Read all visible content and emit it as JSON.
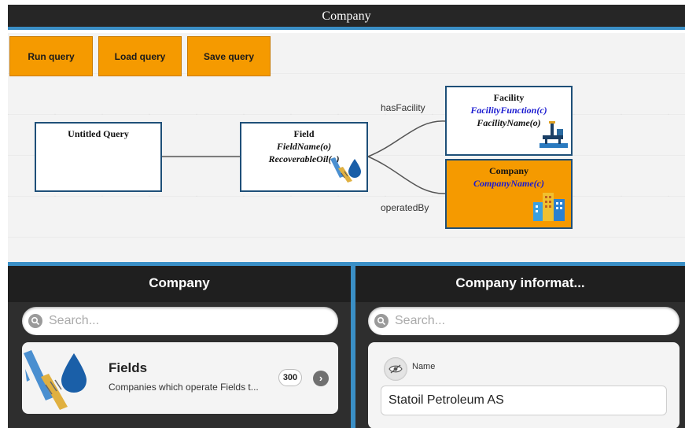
{
  "window": {
    "title": "Company"
  },
  "toolbar": {
    "run_label": "Run query",
    "load_label": "Load query",
    "save_label": "Save query"
  },
  "graph": {
    "nodes": {
      "untitled": {
        "title": "Untitled Query"
      },
      "field": {
        "title": "Field",
        "props": [
          "FieldName(o)",
          "RecoverableOil(o)"
        ],
        "icon": "oil-field-icon"
      },
      "facility": {
        "title": "Facility",
        "props": [
          "FacilityFunction(c)",
          "FacilityName(o)"
        ],
        "icon": "oil-platform-icon"
      },
      "company": {
        "title": "Company",
        "props": [
          "CompanyName(c)"
        ],
        "icon": "office-buildings-icon"
      }
    },
    "edges": {
      "has_facility": "hasFacility",
      "operated_by": "operatedBy"
    }
  },
  "left_panel": {
    "header": "Company",
    "search_placeholder": "Search...",
    "card": {
      "title": "Fields",
      "description": "Companies which operate Fields t...",
      "count": "300",
      "icon": "oil-field-icon"
    }
  },
  "right_panel": {
    "header": "Company informat...",
    "search_placeholder": "Search...",
    "field": {
      "label": "Name",
      "value": "Statoil Petroleum AS",
      "icon": "eye-hidden-icon"
    }
  },
  "colors": {
    "accent": "#3a8fc6",
    "highlight": "#f59a00",
    "header_bg": "#262626",
    "panel_bg": "#2e2e2e"
  }
}
